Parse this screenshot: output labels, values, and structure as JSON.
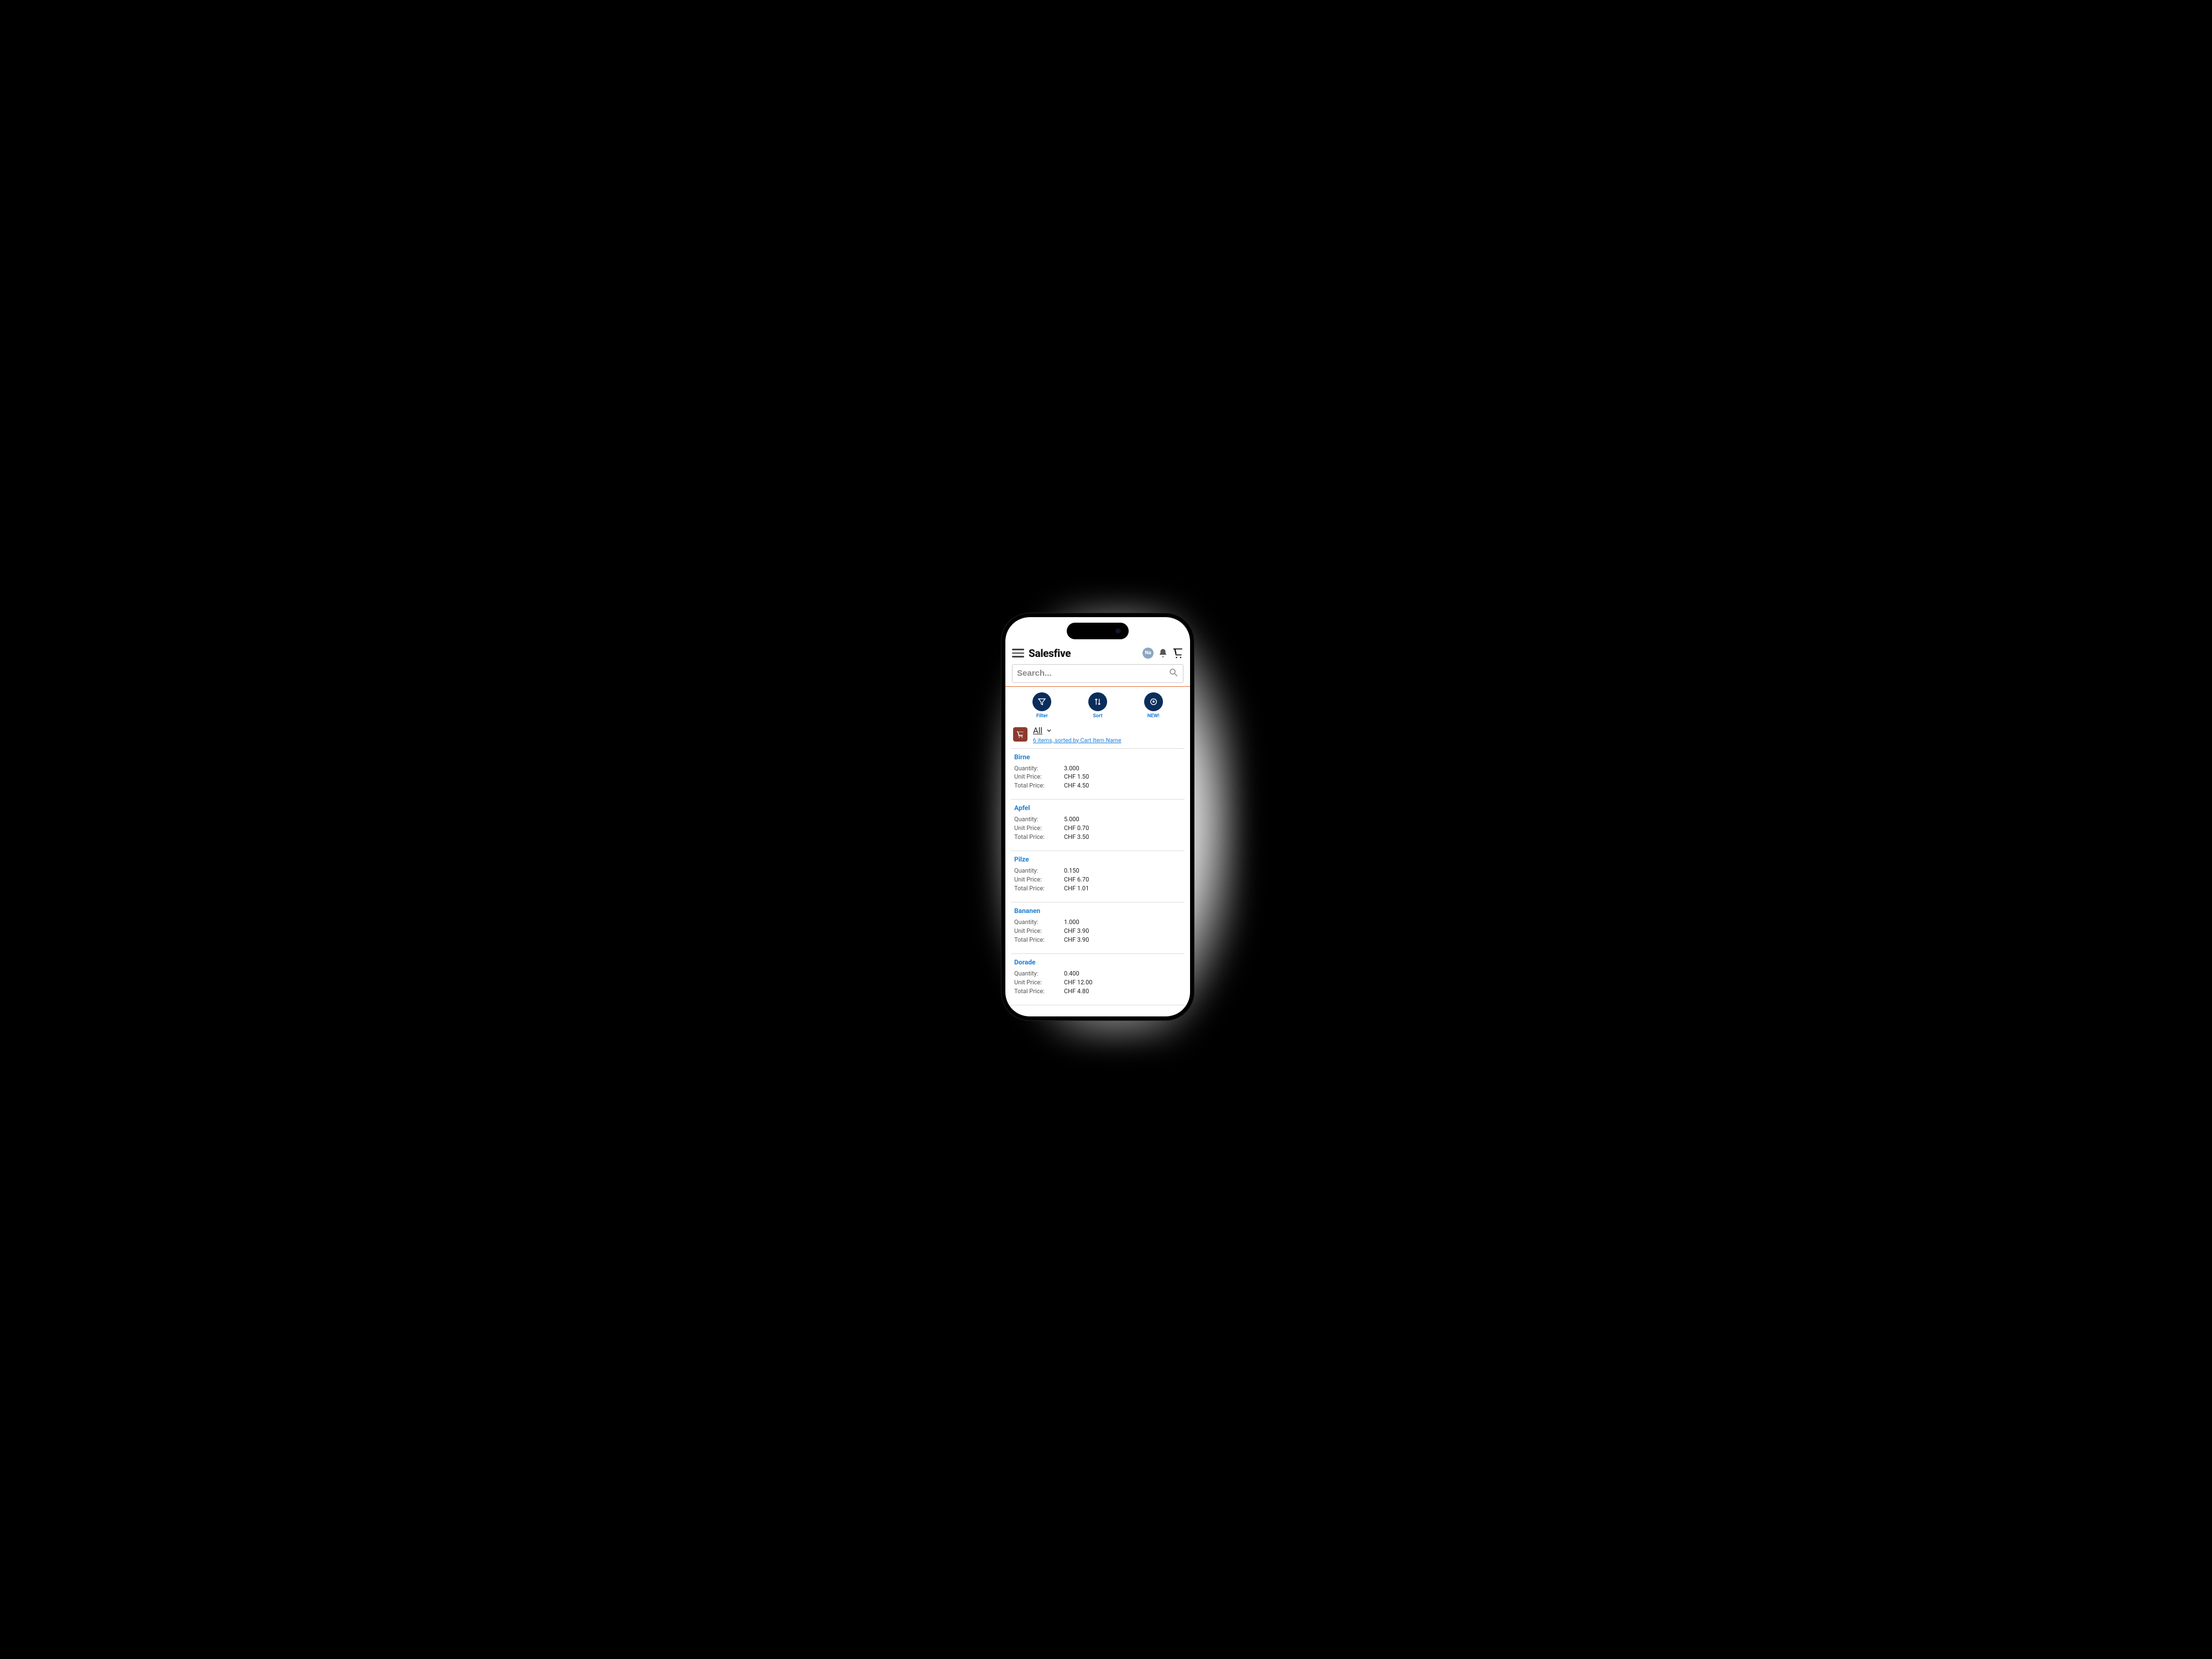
{
  "header": {
    "brand": "Salesfive",
    "badge_text": "Na"
  },
  "search": {
    "placeholder": "Search..."
  },
  "actions": {
    "filter": "Filter",
    "sort": "Sort",
    "new": "NEW!"
  },
  "filterbar": {
    "selection": "All",
    "summary": "6 items, sorted by Cart Item Name"
  },
  "labels": {
    "quantity": "Quantity:",
    "unit_price": "Unit Price:",
    "total_price": "Total Price:"
  },
  "items": [
    {
      "name": "Birne",
      "quantity": "3.000",
      "unit_price": "CHF 1.50",
      "total_price": "CHF 4.50"
    },
    {
      "name": "Apfel",
      "quantity": "5.000",
      "unit_price": "CHF 0.70",
      "total_price": "CHF 3.50"
    },
    {
      "name": "Pilze",
      "quantity": "0.150",
      "unit_price": "CHF 6.70",
      "total_price": "CHF 1.01"
    },
    {
      "name": "Bananen",
      "quantity": "1.000",
      "unit_price": "CHF 3.90",
      "total_price": "CHF 3.90"
    },
    {
      "name": "Dorade",
      "quantity": "0.400",
      "unit_price": "CHF 12.00",
      "total_price": "CHF 4.80"
    }
  ]
}
